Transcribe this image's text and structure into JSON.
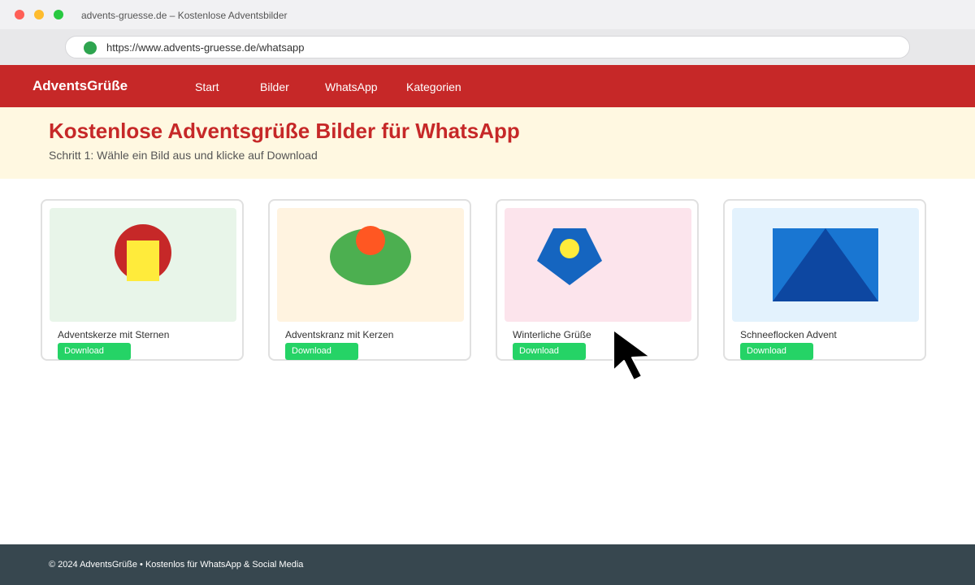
{
  "window": {
    "title": "advents-gruesse.de – Kostenlose Adventsbilder"
  },
  "browser": {
    "url": "https://www.advents-gruesse.de/whatsapp"
  },
  "site": {
    "brand": "AdventsGrüße",
    "nav": [
      {
        "label": "Start"
      },
      {
        "label": "Bilder"
      },
      {
        "label": "WhatsApp"
      },
      {
        "label": "Kategorien"
      }
    ]
  },
  "hero": {
    "title": "Kostenlose Adventsgrüße Bilder für WhatsApp",
    "subtitle": "Schritt 1: Wähle ein Bild aus und klicke auf Download"
  },
  "cards": [
    {
      "title": "Adventskerze mit Sternen",
      "button": "Download",
      "bg": "#e8f5e9",
      "icon": "candle-image"
    },
    {
      "title": "Adventskranz mit Kerzen",
      "button": "Download",
      "bg": "#fff3e0",
      "icon": "wreath-image"
    },
    {
      "title": "Winterliche Grüße",
      "button": "Download",
      "bg": "#fce4ec",
      "icon": "winter-image"
    },
    {
      "title": "Schneeflocken Advent",
      "button": "Download",
      "bg": "#e3f2fd",
      "icon": "snowflake-image"
    }
  ],
  "footer": {
    "text": "© 2024 AdventsGrüße • Kostenlos für WhatsApp & Social Media"
  },
  "colors": {
    "brand": "#c62828",
    "download": "#25d366",
    "hero_bg": "#fff8e1",
    "footer_bg": "#37474f"
  }
}
